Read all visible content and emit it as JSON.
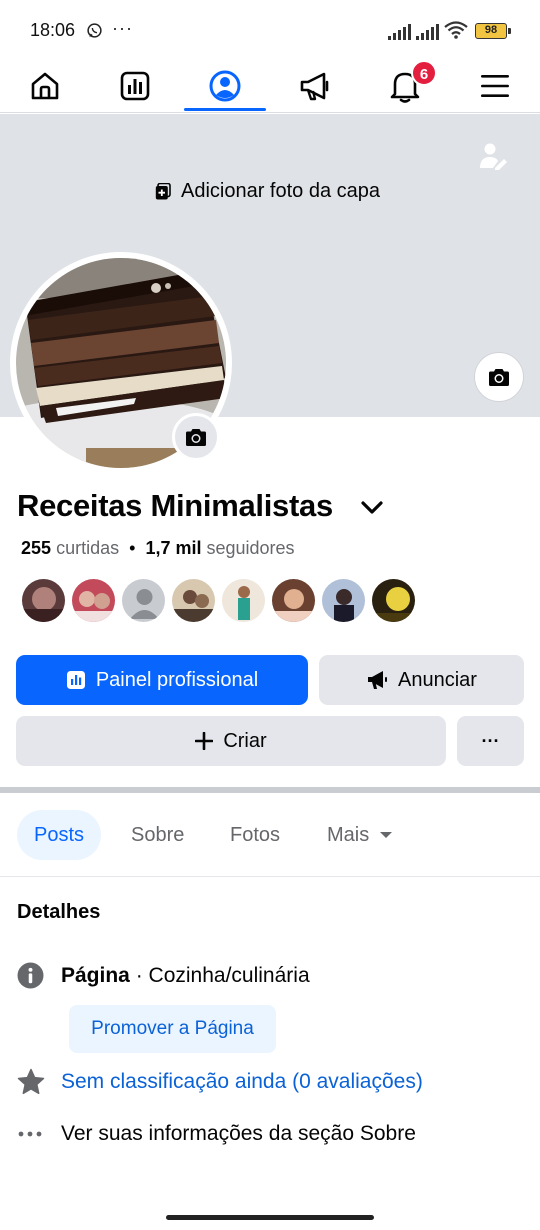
{
  "status_bar": {
    "time": "18:06",
    "more_indicator": "···",
    "battery": "98",
    "icons": [
      "whatsapp-icon",
      "signal-icon",
      "signal-icon",
      "wifi-icon",
      "battery-icon"
    ]
  },
  "nav": {
    "items": [
      {
        "name": "home",
        "icon": "home-icon"
      },
      {
        "name": "dashboard",
        "icon": "bar-chart-icon"
      },
      {
        "name": "profile",
        "icon": "profile-icon",
        "active": true
      },
      {
        "name": "ads",
        "icon": "megaphone-icon"
      },
      {
        "name": "notifications",
        "icon": "bell-icon"
      },
      {
        "name": "menu",
        "icon": "hamburger-icon"
      }
    ],
    "notification_count": "6",
    "accent_color": "#0866ff",
    "badge_color": "#e41e3f"
  },
  "cover": {
    "add_cover_label": "Adicionar foto da capa"
  },
  "profile": {
    "page_name": "Receitas Minimalistas",
    "likes_count": "255",
    "likes_label": "curtidas",
    "followers_count": "1,7 mil",
    "followers_label": "seguidores"
  },
  "buttons": {
    "dashboard": "Painel profissional",
    "advertise": "Anunciar",
    "create": "Criar",
    "more": "···"
  },
  "tabs": [
    {
      "label": "Posts",
      "active": true
    },
    {
      "label": "Sobre"
    },
    {
      "label": "Fotos"
    },
    {
      "label": "Mais"
    }
  ],
  "details": {
    "title": "Detalhes",
    "page_label": "Página",
    "page_separator": " · ",
    "page_category": "Cozinha/culinária",
    "promote_label": "Promover a Página",
    "rating_text": "Sem classificação ainda (0 avaliações)",
    "about_text": "Ver suas informações da seção Sobre"
  }
}
